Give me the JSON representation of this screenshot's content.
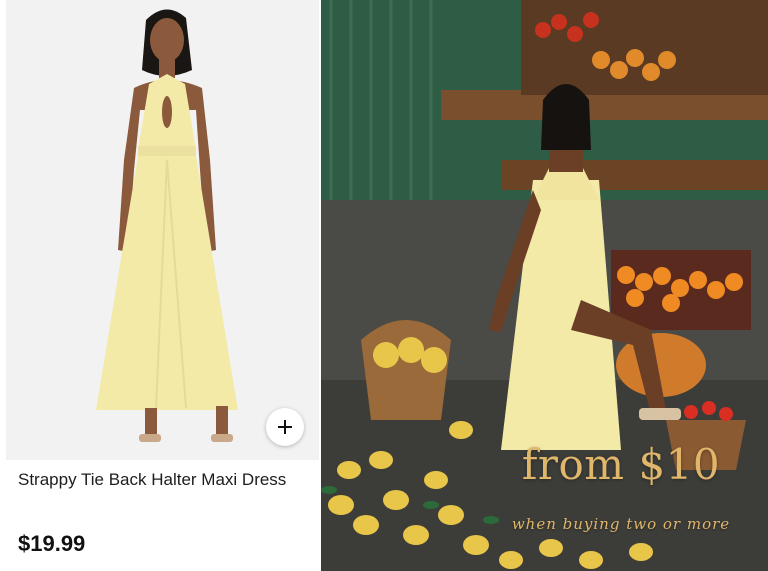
{
  "product": {
    "name": "Strappy Tie Back Halter Maxi Dress",
    "price": "$19.99",
    "add_icon": "plus-icon"
  },
  "promo": {
    "headline": "from $10",
    "subline": "when buying two or more"
  },
  "colors": {
    "dress": "#f4eaa8",
    "promo_text": "#e0b66a",
    "image_bg": "#f2f2f2"
  }
}
